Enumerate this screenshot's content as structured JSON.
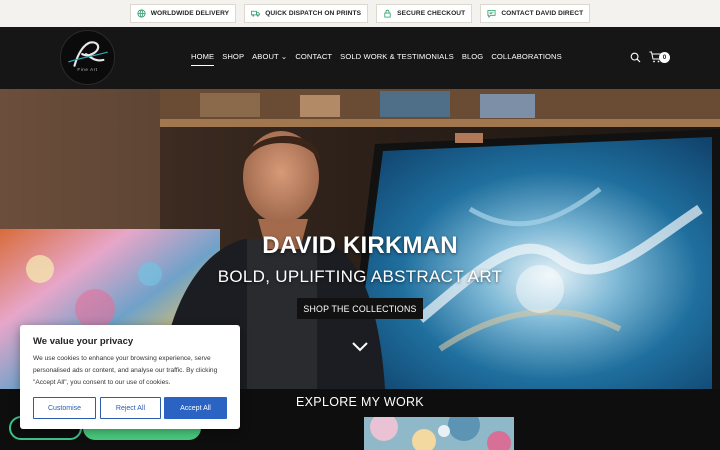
{
  "topbar": {
    "items": [
      {
        "label": "WORLDWIDE DELIVERY",
        "icon": "globe-icon"
      },
      {
        "label": "QUICK DISPATCH ON PRINTS",
        "icon": "truck-icon"
      },
      {
        "label": "SECURE CHECKOUT",
        "icon": "lock-icon"
      },
      {
        "label": "CONTACT DAVID DIRECT",
        "icon": "chat-icon"
      }
    ]
  },
  "header": {
    "logo_text": "Fine Art",
    "nav": [
      {
        "label": "HOME"
      },
      {
        "label": "SHOP"
      },
      {
        "label": "ABOUT ⌄"
      },
      {
        "label": "CONTACT"
      },
      {
        "label": "SOLD WORK & TESTIMONIALS"
      },
      {
        "label": "BLOG"
      },
      {
        "label": "COLLABORATIONS"
      }
    ],
    "cart_count": "0"
  },
  "hero": {
    "title": "DAVID KIRKMAN",
    "subtitle": "BOLD, UPLIFTING ABSTRACT ART",
    "button_label": "SHOP THE COLLECTIONS"
  },
  "explore": {
    "title": "EXPLORE MY WORK"
  },
  "cookie": {
    "title": "We value your privacy",
    "text": "We use cookies to enhance your browsing experience, serve personalised ads or content, and analyse our traffic. By clicking \"Accept All\", you consent to our use of cookies.",
    "customise": "Customise",
    "reject": "Reject All",
    "accept": "Accept All"
  },
  "colors": {
    "header_bg": "#161616",
    "accent_green": "#48c87c",
    "cookie_blue": "#2a63c4"
  }
}
